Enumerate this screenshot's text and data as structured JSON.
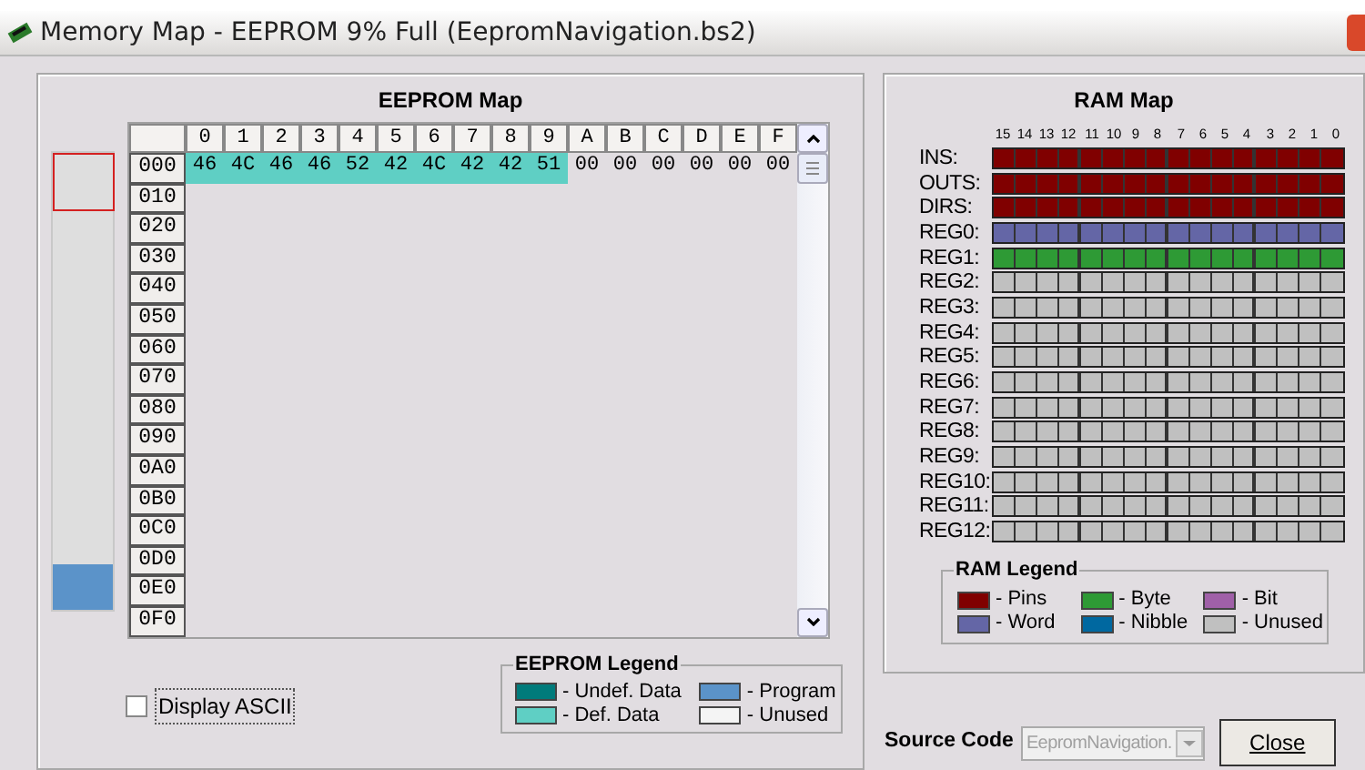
{
  "window": {
    "title": "Memory Map - EEPROM 9% Full (EepromNavigation.bs2)"
  },
  "eeprom": {
    "title": "EEPROM Map",
    "usage_bar": {
      "level": 0.1
    },
    "columns": [
      "0",
      "1",
      "2",
      "3",
      "4",
      "5",
      "6",
      "7",
      "8",
      "9",
      "A",
      "B",
      "C",
      "D",
      "E",
      "F"
    ],
    "rows": [
      {
        "address": "000",
        "cells": [
          {
            "value": "46",
            "kind": "defined"
          },
          {
            "value": "4C",
            "kind": "defined"
          },
          {
            "value": "46",
            "kind": "defined"
          },
          {
            "value": "46",
            "kind": "defined"
          },
          {
            "value": "52",
            "kind": "defined"
          },
          {
            "value": "42",
            "kind": "defined"
          },
          {
            "value": "4C",
            "kind": "defined"
          },
          {
            "value": "42",
            "kind": "defined"
          },
          {
            "value": "42",
            "kind": "defined"
          },
          {
            "value": "51",
            "kind": "defined"
          },
          {
            "value": "00",
            "kind": "unused"
          },
          {
            "value": "00",
            "kind": "unused"
          },
          {
            "value": "00",
            "kind": "unused"
          },
          {
            "value": "00",
            "kind": "unused"
          },
          {
            "value": "00",
            "kind": "unused"
          },
          {
            "value": "00",
            "kind": "unused"
          }
        ]
      },
      {
        "address": "010"
      },
      {
        "address": "020"
      },
      {
        "address": "030"
      },
      {
        "address": "040"
      },
      {
        "address": "050"
      },
      {
        "address": "060"
      },
      {
        "address": "070"
      },
      {
        "address": "080"
      },
      {
        "address": "090"
      },
      {
        "address": "0A0"
      },
      {
        "address": "0B0"
      },
      {
        "address": "0C0"
      },
      {
        "address": "0D0"
      },
      {
        "address": "0E0"
      },
      {
        "address": "0F0"
      }
    ],
    "display_ascii": {
      "label": "Display ASCII",
      "checked": false
    },
    "legend": {
      "title": "EEPROM Legend",
      "items": [
        {
          "label": "- Undef. Data",
          "color": "#007b7b"
        },
        {
          "label": "- Program",
          "color": "#5b93c9"
        },
        {
          "label": "- Def. Data",
          "color": "#5fcfc4"
        },
        {
          "label": "- Unused",
          "color": "#f4f4f4"
        }
      ]
    }
  },
  "ram": {
    "title": "RAM Map",
    "bits": [
      "15",
      "14",
      "13",
      "12",
      "11",
      "10",
      "9",
      "8",
      "7",
      "6",
      "5",
      "4",
      "3",
      "2",
      "1",
      "0"
    ],
    "registers": [
      {
        "name": "INS:",
        "kind": "pins"
      },
      {
        "name": "OUTS:",
        "kind": "pins"
      },
      {
        "name": "DIRS:",
        "kind": "pins"
      },
      {
        "name": "REG0:",
        "kind": "word"
      },
      {
        "name": "REG1:",
        "kind": "byte"
      },
      {
        "name": "REG2:",
        "kind": "unused"
      },
      {
        "name": "REG3:",
        "kind": "unused"
      },
      {
        "name": "REG4:",
        "kind": "unused"
      },
      {
        "name": "REG5:",
        "kind": "unused"
      },
      {
        "name": "REG6:",
        "kind": "unused"
      },
      {
        "name": "REG7:",
        "kind": "unused"
      },
      {
        "name": "REG8:",
        "kind": "unused"
      },
      {
        "name": "REG9:",
        "kind": "unused"
      },
      {
        "name": "REG10:",
        "kind": "unused"
      },
      {
        "name": "REG11:",
        "kind": "unused"
      },
      {
        "name": "REG12:",
        "kind": "unused"
      }
    ],
    "legend": {
      "title": "RAM Legend",
      "items": [
        {
          "label": "- Pins",
          "kind": "pins"
        },
        {
          "label": "- Byte",
          "kind": "byte"
        },
        {
          "label": "- Bit",
          "kind": "bit"
        },
        {
          "label": "- Word",
          "kind": "word"
        },
        {
          "label": "- Nibble",
          "kind": "nibble"
        },
        {
          "label": "- Unused",
          "kind": "unused"
        }
      ]
    }
  },
  "source_code": {
    "label": "Source Code",
    "value": "EepromNavigation.",
    "disabled": true
  },
  "close_button": {
    "label": "Close"
  }
}
